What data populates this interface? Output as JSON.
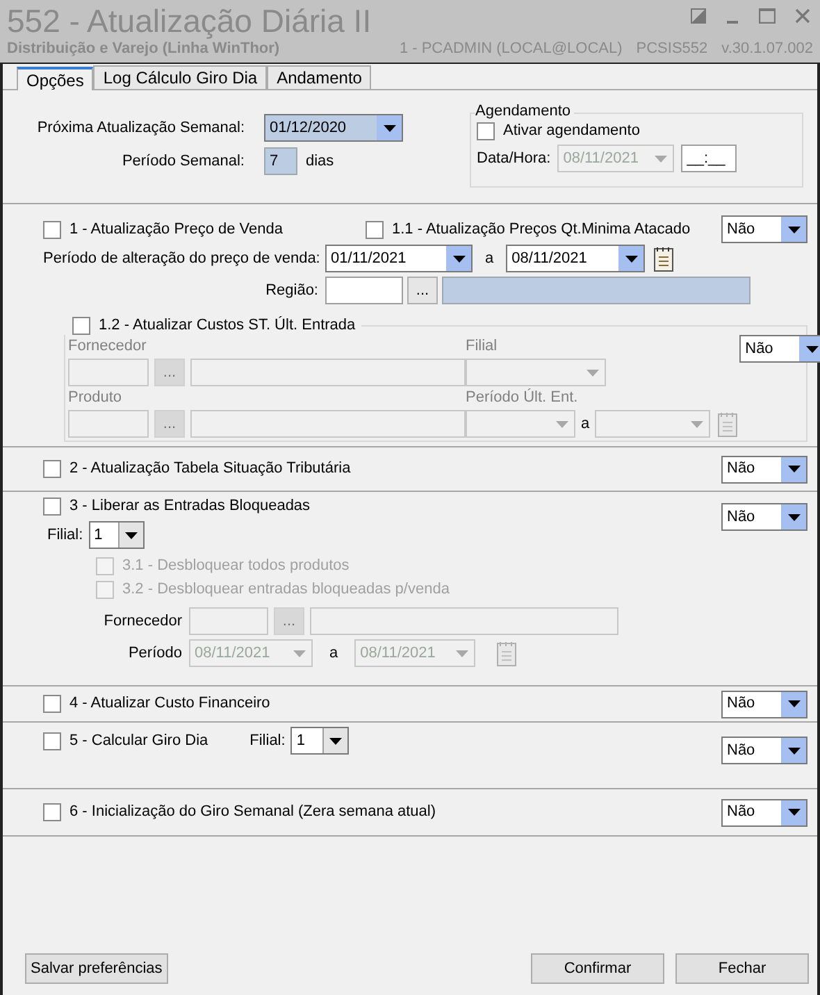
{
  "window": {
    "title": "552 - Atualização Diária II",
    "subtitle": "Distribuição e Varejo (Linha WinThor)",
    "user": "1 - PCADMIN (LOCAL@LOCAL)",
    "program": "PCSIS552",
    "version": "v.30.1.07.002"
  },
  "tabs": [
    {
      "label": "Opções",
      "selected": true
    },
    {
      "label": "Log Cálculo Giro Dia",
      "selected": false
    },
    {
      "label": "Andamento",
      "selected": false
    }
  ],
  "weekly": {
    "next_update_label": "Próxima Atualização Semanal:",
    "next_update": "01/12/2020",
    "period_label": "Período Semanal:",
    "period": "7",
    "period_unit": "dias"
  },
  "scheduling": {
    "title": "Agendamento",
    "enable_label": "Ativar agendamento",
    "checked": false,
    "datetime_label": "Data/Hora:",
    "date": "08/11/2021",
    "time": "__:__"
  },
  "section_1": {
    "label": "1 - Atualização Preço de Venda",
    "checked": false,
    "sub_label": "1.1 - Atualização Preços Qt.Minima Atacado",
    "sub_checked": false,
    "option": "Não",
    "period_label": "Período de alteração do preço de venda:",
    "date_from": "01/11/2021",
    "to_label": "a",
    "date_to": "08/11/2021",
    "region_label": "Região:",
    "lookup_button": "...",
    "group": {
      "label": "1.2 - Atualizar Custos ST. Últ. Entrada",
      "checked": false,
      "option": "Não",
      "supplier_label": "Fornecedor",
      "branch_label": "Filial",
      "product_label": "Produto",
      "period_label": "Período Últ. Ent.",
      "to_label": "a",
      "lookup_button": "..."
    }
  },
  "section_2": {
    "label": "2 - Atualização Tabela Situação Tributária",
    "checked": false,
    "option": "Não"
  },
  "section_3": {
    "label": "3 - Liberar as Entradas Bloqueadas",
    "checked": false,
    "option": "Não",
    "branch_label": "Filial:",
    "branch": "1",
    "sub_options": [
      {
        "label": "3.1 - Desbloquear todos produtos",
        "checked": false,
        "disabled": true
      },
      {
        "label": "3.2 - Desbloquear entradas bloqueadas p/venda",
        "checked": false,
        "disabled": true
      }
    ],
    "supplier_label": "Fornecedor",
    "lookup_button": "...",
    "period_label": "Período",
    "date_from": "08/11/2021",
    "to_label": "a",
    "date_to": "08/11/2021"
  },
  "section_4": {
    "label": "4 - Atualizar Custo Financeiro",
    "checked": false,
    "option": "Não"
  },
  "section_5": {
    "label": "5 - Calcular Giro Dia",
    "checked": false,
    "option": "Não",
    "branch_label": "Filial:",
    "branch": "1"
  },
  "section_6": {
    "label": "6 - Inicialização do Giro Semanal (Zera semana atual)",
    "checked": false,
    "option": "Não"
  },
  "buttons": {
    "save": "Salvar preferências",
    "confirm": "Confirmar",
    "close": "Fechar"
  }
}
